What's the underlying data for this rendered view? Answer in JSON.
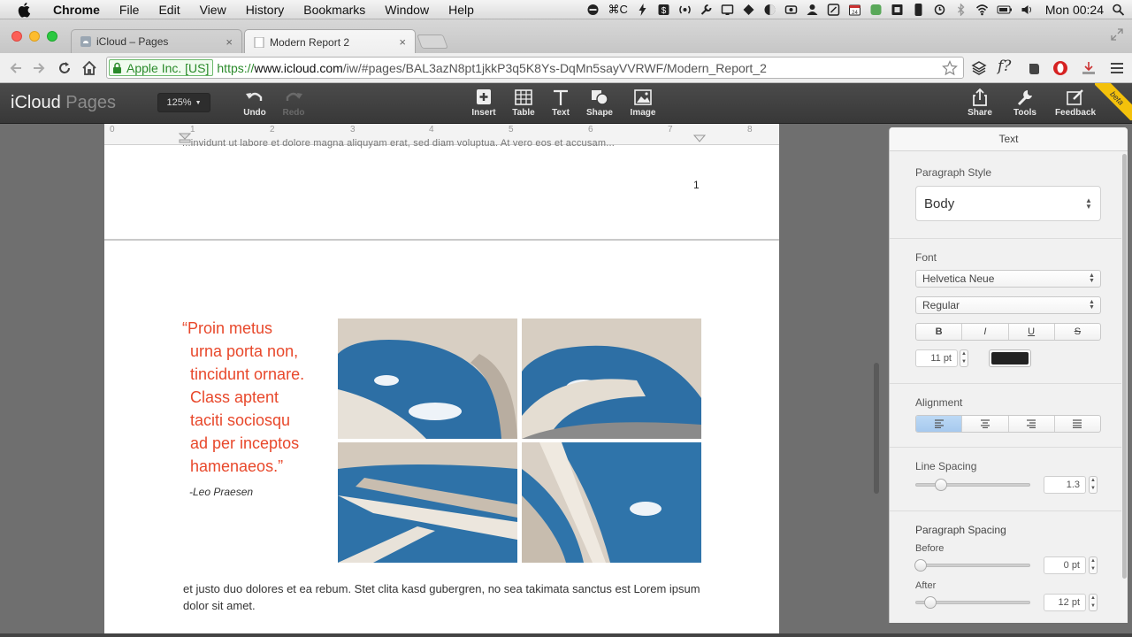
{
  "menubar": {
    "app_name": "Chrome",
    "menus": [
      "File",
      "Edit",
      "View",
      "History",
      "Bookmarks",
      "Window",
      "Help"
    ],
    "clock": "Mon 00:24"
  },
  "tabs": [
    {
      "title": "iCloud – Pages",
      "active": false
    },
    {
      "title": "Modern Report 2",
      "active": true
    }
  ],
  "address_bar": {
    "ev_label": "Apple Inc. [US]",
    "url_scheme": "https://",
    "url_host": "www.icloud.com",
    "url_path": "/iw/#pages/BAL3azN8pt1jkkP3q5K8Ys-DqMn5sayVVRWF/Modern_Report_2"
  },
  "pages_toolbar": {
    "brand_primary": "iCloud",
    "brand_secondary": "Pages",
    "zoom": "125%",
    "undo": "Undo",
    "redo": "Redo",
    "insert": "Insert",
    "table": "Table",
    "text": "Text",
    "shape": "Shape",
    "image": "Image",
    "share": "Share",
    "tools": "Tools",
    "feedback": "Feedback",
    "beta": "beta"
  },
  "ruler": {
    "ticks": [
      "0",
      "1",
      "2",
      "3",
      "4",
      "5",
      "6",
      "7",
      "8"
    ]
  },
  "document": {
    "page1_ghost_text": "...invidunt ut labore et dolore magna aliquyam erat, sed diam voluptua. At vero eos et accusam...",
    "page_number": "1",
    "quote_lines": [
      "“Proin metus",
      "urna porta non,",
      "tincidunt ornare.",
      "Class aptent",
      "taciti sociosqu",
      "ad per inceptos",
      "hamenaeos.”"
    ],
    "attribution": "-Leo Praesen",
    "body_text": "et justo duo dolores et ea rebum. Stet clita kasd gubergren, no sea takimata sanctus est Lorem ipsum dolor sit amet.",
    "accent_color": "#e8482b"
  },
  "inspector": {
    "title": "Text",
    "paragraph_style_label": "Paragraph Style",
    "paragraph_style_value": "Body",
    "font_label": "Font",
    "font_family": "Helvetica Neue",
    "font_style": "Regular",
    "format_buttons": [
      "B",
      "I",
      "U",
      "S"
    ],
    "font_size": "11 pt",
    "text_color": "#222222",
    "alignment_label": "Alignment",
    "line_spacing_label": "Line Spacing",
    "line_spacing_value": "1.3",
    "line_spacing_level": 0.2,
    "paragraph_spacing_label": "Paragraph Spacing",
    "before_label": "Before",
    "before_value": "0 pt",
    "before_level": 0.0,
    "after_label": "After",
    "after_value": "12 pt",
    "after_level": 0.1
  }
}
